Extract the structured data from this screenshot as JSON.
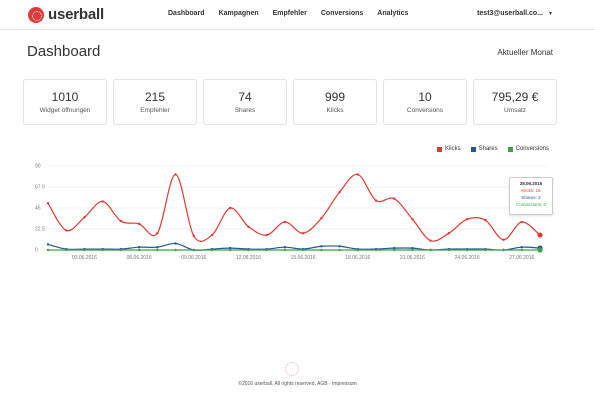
{
  "app": {
    "name": "userball"
  },
  "nav": {
    "items": [
      "Dashboard",
      "Kampagnen",
      "Empfehler",
      "Conversions",
      "Analytics"
    ],
    "user": "test3@userball.co..."
  },
  "header": {
    "title": "Dashboard",
    "period": "Aktueller Monat"
  },
  "kpis": [
    {
      "value": "1010",
      "label": "Widget öffnungen"
    },
    {
      "value": "215",
      "label": "Empfehler"
    },
    {
      "value": "74",
      "label": "Shares"
    },
    {
      "value": "999",
      "label": "Klicks"
    },
    {
      "value": "10",
      "label": "Conversions"
    },
    {
      "value": "795,29 €",
      "label": "Umsatz"
    }
  ],
  "colors": {
    "klicks": "#e03a32",
    "shares": "#1f5a94",
    "conversions": "#3aa24a"
  },
  "chart_data": {
    "type": "line",
    "x": [
      "01.06.2016",
      "02.06.2016",
      "03.06.2016",
      "04.06.2016",
      "05.06.2016",
      "06.06.2016",
      "07.06.2016",
      "08.06.2016",
      "09.06.2016",
      "10.06.2016",
      "11.06.2016",
      "12.06.2016",
      "13.06.2016",
      "14.06.2016",
      "15.06.2016",
      "16.06.2016",
      "17.06.2016",
      "18.06.2016",
      "19.06.2016",
      "20.06.2016",
      "21.06.2016",
      "22.06.2016",
      "23.06.2016",
      "24.06.2016",
      "25.06.2016",
      "26.06.2016",
      "27.06.2016",
      "28.06.2016"
    ],
    "xticks": [
      "03.06.2016",
      "06.06.2016",
      "09.06.2016",
      "12.06.2016",
      "15.06.2016",
      "18.06.2016",
      "21.06.2016",
      "24.06.2016",
      "27.06.2016"
    ],
    "yticks": [
      "90",
      "67.5",
      "45",
      "22.5",
      "0"
    ],
    "ylim": [
      0,
      90
    ],
    "series": [
      {
        "name": "Klicks",
        "values": [
          50,
          21,
          35,
          52,
          31,
          28,
          18,
          81,
          15,
          16,
          45,
          25,
          16,
          30,
          18,
          34,
          62,
          81,
          53,
          55,
          33,
          10,
          18,
          33,
          32,
          11,
          30,
          16
        ]
      },
      {
        "name": "Shares",
        "values": [
          6,
          1,
          1,
          1,
          1,
          3,
          3,
          7,
          0,
          1,
          2,
          1,
          1,
          3,
          1,
          4,
          4,
          1,
          1,
          2,
          2,
          0,
          1,
          1,
          1,
          0,
          3,
          2
        ]
      },
      {
        "name": "Conversions",
        "values": [
          0,
          0,
          0,
          0,
          0,
          0,
          0,
          0,
          0,
          0,
          0,
          0,
          0,
          0,
          0,
          0,
          0,
          0,
          0,
          0,
          0,
          0,
          0,
          0,
          0,
          0,
          0,
          0
        ]
      }
    ],
    "grid": true,
    "legend_position": "top-right",
    "tooltip": {
      "date": "28.06.2016",
      "lines": [
        "Klicks: 16",
        "Shares: 2",
        "Conversions: 0"
      ]
    }
  },
  "footer": {
    "text": "©2016 userball. All rights reserved. AGB · Impressum"
  }
}
